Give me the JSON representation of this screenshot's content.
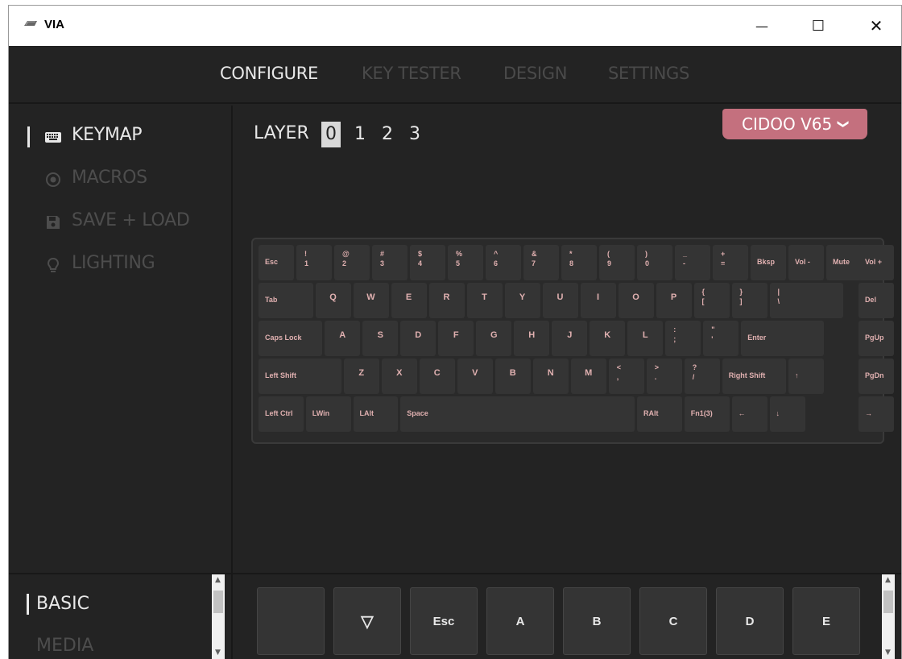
{
  "window": {
    "title": "VIA",
    "min_glyph": "—",
    "max_glyph": "☐",
    "close_glyph": "✕"
  },
  "topnav": {
    "tabs": [
      "CONFIGURE",
      "KEY TESTER",
      "DESIGN",
      "SETTINGS"
    ],
    "active": "CONFIGURE"
  },
  "sidebar": {
    "items": [
      {
        "label": "KEYMAP",
        "icon": "keyboard-icon",
        "active": true
      },
      {
        "label": "MACROS",
        "icon": "record-icon",
        "active": false
      },
      {
        "label": "SAVE + LOAD",
        "icon": "floppy-disk-icon",
        "active": false
      },
      {
        "label": "LIGHTING",
        "icon": "lightbulb-icon",
        "active": false
      }
    ]
  },
  "layer": {
    "label": "LAYER",
    "numbers": [
      "0",
      "1",
      "2",
      "3"
    ],
    "active": "0"
  },
  "device": {
    "name": "CIDOO V65",
    "chevron": "❯"
  },
  "keyboard": {
    "rows": [
      [
        {
          "label": "Esc"
        },
        {
          "top": "!",
          "bottom": "1"
        },
        {
          "top": "@",
          "bottom": "2"
        },
        {
          "top": "#",
          "bottom": "3"
        },
        {
          "top": "$",
          "bottom": "4"
        },
        {
          "top": "%",
          "bottom": "5"
        },
        {
          "top": "^",
          "bottom": "6"
        },
        {
          "top": "&",
          "bottom": "7"
        },
        {
          "top": "*",
          "bottom": "8"
        },
        {
          "top": "(",
          "bottom": "9"
        },
        {
          "top": ")",
          "bottom": "0"
        },
        {
          "top": "_",
          "bottom": "-"
        },
        {
          "top": "+",
          "bottom": "="
        },
        {
          "label": "Bksp"
        },
        {
          "label": "Vol -"
        },
        {
          "label": "Mute"
        },
        {
          "label": "Vol +"
        }
      ],
      [
        {
          "label": "Tab"
        },
        {
          "center": "Q"
        },
        {
          "center": "W"
        },
        {
          "center": "E"
        },
        {
          "center": "R"
        },
        {
          "center": "T"
        },
        {
          "center": "Y"
        },
        {
          "center": "U"
        },
        {
          "center": "I"
        },
        {
          "center": "O"
        },
        {
          "center": "P"
        },
        {
          "top": "{",
          "bottom": "["
        },
        {
          "top": "}",
          "bottom": "]"
        },
        {
          "top": "|",
          "bottom": "\\"
        },
        {
          "label": "Del"
        }
      ],
      [
        {
          "label": "Caps Lock"
        },
        {
          "center": "A"
        },
        {
          "center": "S"
        },
        {
          "center": "D"
        },
        {
          "center": "F"
        },
        {
          "center": "G"
        },
        {
          "center": "H"
        },
        {
          "center": "J"
        },
        {
          "center": "K"
        },
        {
          "center": "L"
        },
        {
          "top": ":",
          "bottom": ";"
        },
        {
          "top": "\"",
          "bottom": "'"
        },
        {
          "label": "Enter"
        },
        {
          "label": "PgUp"
        }
      ],
      [
        {
          "label": "Left Shift"
        },
        {
          "center": "Z"
        },
        {
          "center": "X"
        },
        {
          "center": "C"
        },
        {
          "center": "V"
        },
        {
          "center": "B"
        },
        {
          "center": "N"
        },
        {
          "center": "M"
        },
        {
          "top": "<",
          "bottom": ","
        },
        {
          "top": ">",
          "bottom": "."
        },
        {
          "top": "?",
          "bottom": "/"
        },
        {
          "label": "Right Shift"
        },
        {
          "label": "↑"
        },
        {
          "label": "PgDn"
        }
      ],
      [
        {
          "label": "Left Ctrl"
        },
        {
          "label": "LWin"
        },
        {
          "label": "LAlt"
        },
        {
          "label": "Space"
        },
        {
          "label": "RAlt"
        },
        {
          "label": "Fn1(3)"
        },
        {
          "label": "←"
        },
        {
          "label": "↓"
        },
        {
          "label": "→"
        }
      ]
    ]
  },
  "categories": {
    "items": [
      "BASIC",
      "MEDIA"
    ],
    "active": "BASIC"
  },
  "palette": {
    "keys": [
      "",
      "▽",
      "Esc",
      "A",
      "B",
      "C",
      "D",
      "E"
    ]
  },
  "colors": {
    "accent": "#c4707e",
    "background": "#232323",
    "key": "#343434",
    "key_legend": "#e0b0b0"
  }
}
